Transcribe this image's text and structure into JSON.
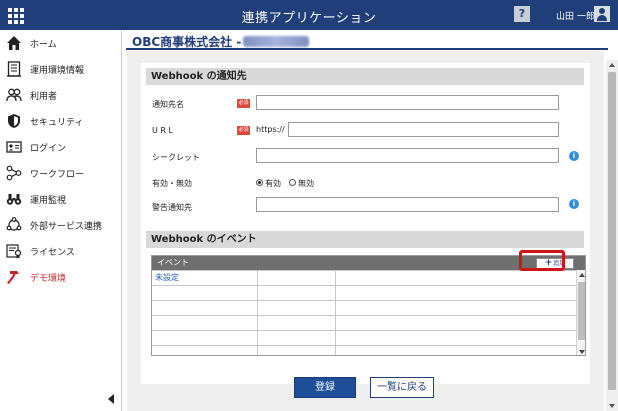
{
  "header": {
    "title": "連携アプリケーション",
    "help_label": "?",
    "user_name": "山田 一郎"
  },
  "sidebar": {
    "items": [
      {
        "label": "ホーム",
        "icon": "home-icon"
      },
      {
        "label": "運用環境情報",
        "icon": "building-icon"
      },
      {
        "label": "利用者",
        "icon": "users-icon"
      },
      {
        "label": "セキュリティ",
        "icon": "shield-icon"
      },
      {
        "label": "ログイン",
        "icon": "id-card-icon"
      },
      {
        "label": "ワークフロー",
        "icon": "workflow-icon"
      },
      {
        "label": "運用監視",
        "icon": "binoculars-icon"
      },
      {
        "label": "外部サービス連携",
        "icon": "network-icon"
      },
      {
        "label": "ライセンス",
        "icon": "certificate-icon"
      },
      {
        "label": "デモ環境",
        "icon": "hammer-icon",
        "active": true,
        "color": "#c1272d"
      }
    ]
  },
  "page": {
    "company": "OBC商事株式会社 -"
  },
  "notify": {
    "section_title": "Webhook の通知先",
    "fields": {
      "name_label": "通知先名",
      "url_label": "U R L",
      "url_prefix": "https://",
      "secret_label": "シークレット",
      "enabled_label": "有効・無効",
      "alert_label": "警告通知先"
    },
    "required_badge": "必須",
    "enabled_options": [
      "有効",
      "無効"
    ],
    "enabled_selected": "有効"
  },
  "events": {
    "section_title": "Webhook のイベント",
    "column_header": "イベント",
    "add_button": "追加",
    "rows": [
      [
        "未設定",
        "",
        ""
      ],
      [
        "",
        "",
        ""
      ],
      [
        "",
        "",
        ""
      ],
      [
        "",
        "",
        ""
      ],
      [
        "",
        "",
        ""
      ],
      [
        "",
        "",
        ""
      ]
    ]
  },
  "actions": {
    "register": "登録",
    "back_to_list": "一覧に戻る"
  },
  "colors": {
    "brand": "#1f3e7a",
    "required": "#e0463e",
    "info": "#2e8fd6",
    "highlight": "#d1141c"
  }
}
